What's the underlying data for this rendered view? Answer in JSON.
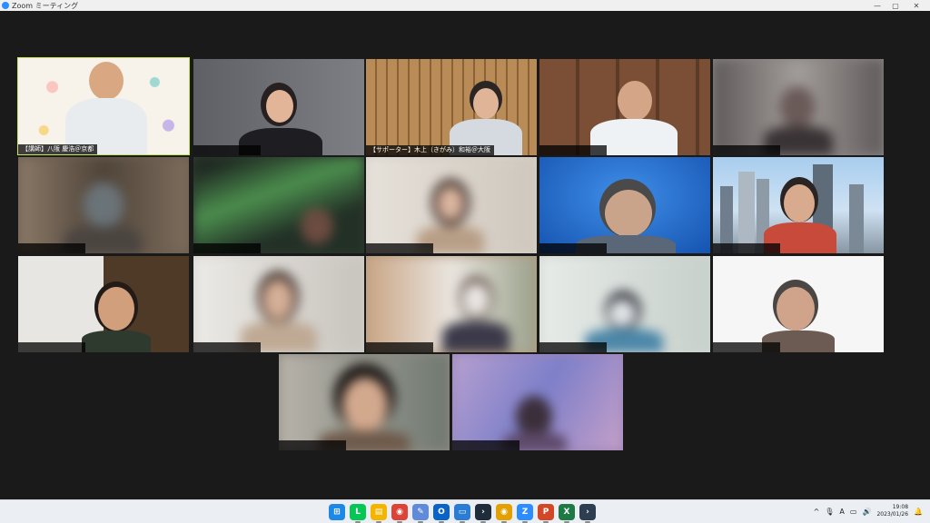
{
  "window": {
    "title": "Zoom ミーティング",
    "controls": [
      "—",
      "▢",
      "✕"
    ]
  },
  "tiles": [
    {
      "label": "【講師】八阪 慶浩＠京都",
      "speaking": true
    },
    {
      "label": ""
    },
    {
      "label": "【サポーター】木上（きがみ）和裕＠大阪"
    },
    {
      "label": ""
    },
    {
      "label": ""
    },
    {
      "label": ""
    },
    {
      "label": ""
    },
    {
      "label": ""
    },
    {
      "label": ""
    },
    {
      "label": ""
    },
    {
      "label": ""
    },
    {
      "label": ""
    },
    {
      "label": ""
    },
    {
      "label": ""
    },
    {
      "label": ""
    },
    {
      "label": ""
    },
    {
      "label": ""
    }
  ],
  "taskbar": {
    "apps": [
      {
        "name": "windows-start",
        "glyph": "⊞",
        "color": "#1e88e5"
      },
      {
        "name": "line",
        "glyph": "L",
        "color": "#06c755"
      },
      {
        "name": "file-explorer",
        "glyph": "▤",
        "color": "#f4b400"
      },
      {
        "name": "chrome",
        "glyph": "◉",
        "color": "#db4437"
      },
      {
        "name": "notepad",
        "glyph": "✎",
        "color": "#5f8bd8"
      },
      {
        "name": "outlook",
        "glyph": "O",
        "color": "#0a64c8"
      },
      {
        "name": "remote-desktop",
        "glyph": "▭",
        "color": "#2b7cd3"
      },
      {
        "name": "terminal",
        "glyph": "›",
        "color": "#1f2d3a"
      },
      {
        "name": "chrome-profile",
        "glyph": "◉",
        "color": "#e3a000"
      },
      {
        "name": "zoom",
        "glyph": "Z",
        "color": "#2d8cff"
      },
      {
        "name": "powerpoint",
        "glyph": "P",
        "color": "#d24726"
      },
      {
        "name": "excel",
        "glyph": "X",
        "color": "#1d7a45"
      },
      {
        "name": "terminal-2",
        "glyph": "›",
        "color": "#2c3e50"
      }
    ],
    "tray": {
      "chevron": "^",
      "mic": "🎙",
      "ime": "A",
      "network": "▭",
      "volume": "🔊",
      "time": "19:08",
      "date": "2023/01/26",
      "notifications": "🔔"
    }
  }
}
